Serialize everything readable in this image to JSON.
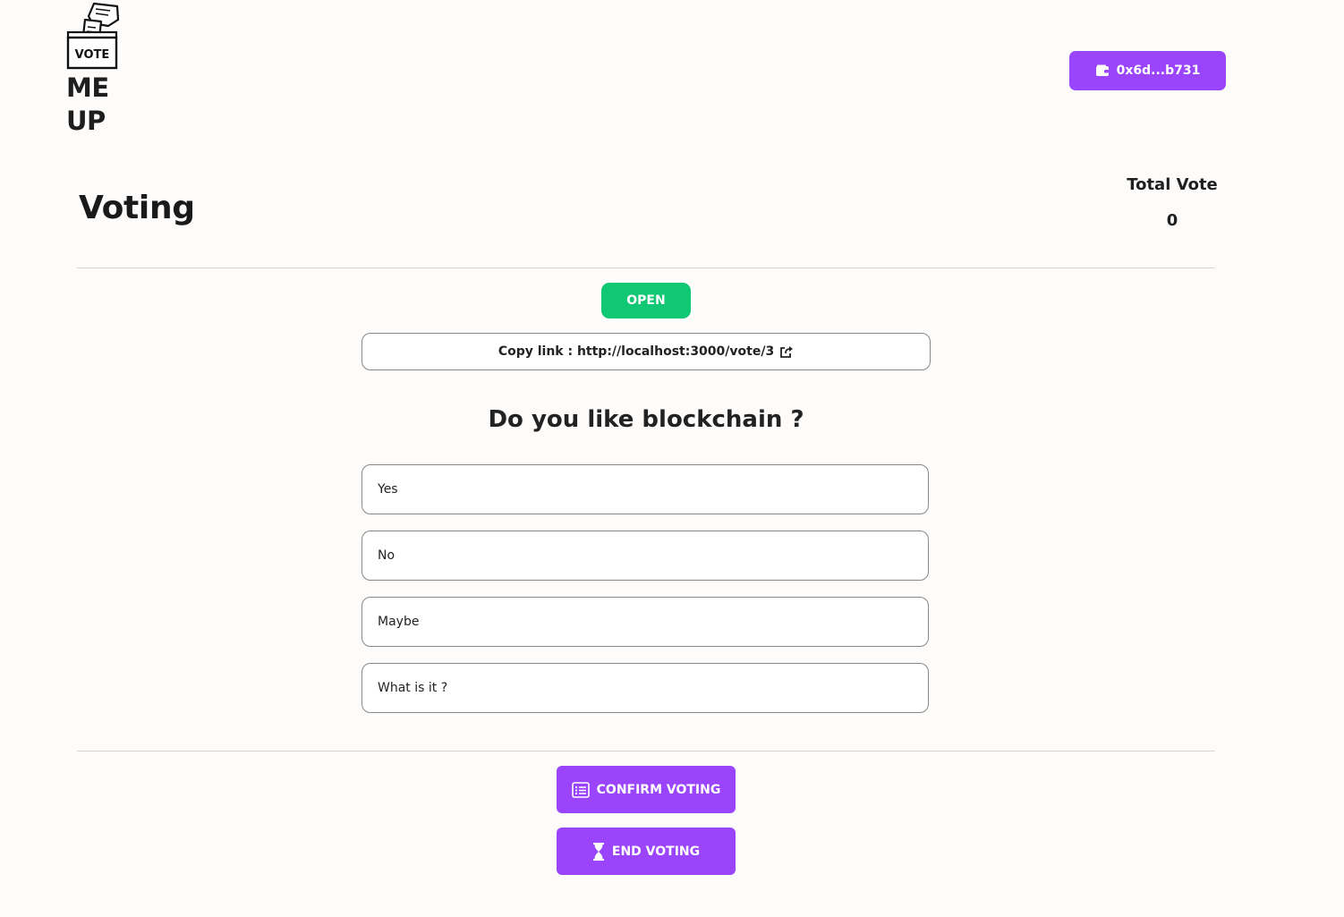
{
  "brand": {
    "logo_badge": "VOTE",
    "name_line1": "ME",
    "name_line2": "UP"
  },
  "header": {
    "wallet_address": "0x6d...b731",
    "wallet_icon": "wallet-icon"
  },
  "page": {
    "title": "Voting",
    "total_vote_label": "Total Vote",
    "total_vote_value": "0",
    "status": "OPEN",
    "status_color": "#10c773",
    "copy_link_text": "Copy link : http://localhost:3000/vote/3",
    "copy_link_icon": "share-icon",
    "question": "Do you like blockchain ?"
  },
  "options": [
    "Yes",
    "No",
    "Maybe",
    "What is it ?"
  ],
  "actions": {
    "confirm_label": "CONFIRM VOTING",
    "confirm_icon": "list-icon",
    "end_label": "END VOTING",
    "end_icon": "hourglass-icon"
  },
  "colors": {
    "accent": "#9a45fb",
    "open": "#10c773"
  }
}
